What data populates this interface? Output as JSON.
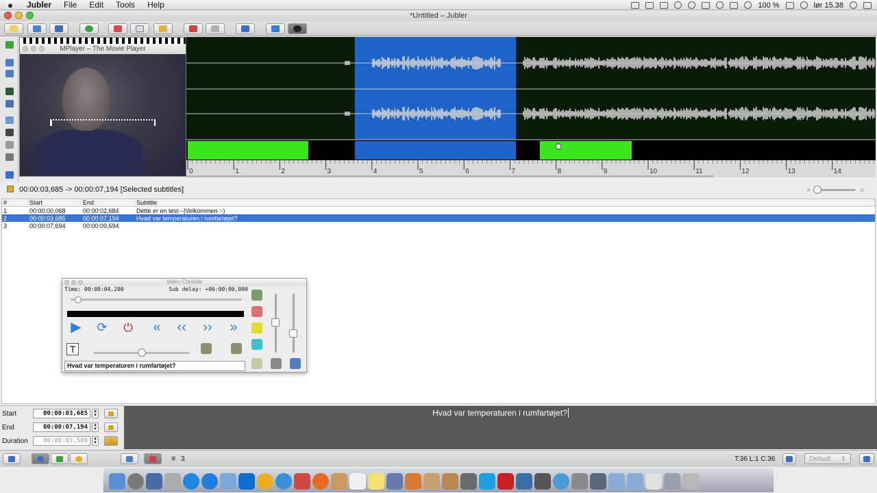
{
  "menubar": {
    "apple": "",
    "app_name": "Jubler",
    "items": [
      "File",
      "Edit",
      "Tools",
      "Help"
    ],
    "battery": "100 %",
    "clock": "lør 15.38"
  },
  "window": {
    "title": "*Untitled – Jubler"
  },
  "toolbar": {
    "icons": [
      "new-file-icon",
      "open-file-icon",
      "save-icon",
      "info-icon",
      "cut-icon",
      "copy-icon",
      "paste-icon",
      "undo-icon",
      "redo-icon",
      "sort-icon",
      "play-icon",
      "preview-eye-icon"
    ]
  },
  "mplayer": {
    "title": "MPlayer – The Movie Player"
  },
  "waveform": {
    "ruler_labels": [
      "0",
      "1",
      "2",
      "3",
      "4",
      "5",
      "6",
      "7",
      "8",
      "9",
      "10",
      "11",
      "12",
      "13",
      "14"
    ],
    "colors": {
      "selection": "#1e64c8",
      "subtitle_block": "#3ce61e",
      "background": "#0a1b0a",
      "wave": "#d2d2d2"
    }
  },
  "selection_info": "00:00:03,685 -> 00:00:07,194 [Selected subtitles]",
  "table": {
    "headers": [
      "#",
      "Start",
      "End",
      "Subtitle"
    ],
    "rows": [
      {
        "num": "1",
        "start": "00:00:00,068",
        "end": "00:00:02,684",
        "subtitle": "Dette er en test –|Velkommen :-)"
      },
      {
        "num": "2",
        "start": "00:00:03,685",
        "end": "00:00:07,194",
        "subtitle": "Hvad var temperaturen i rumfartøjet?"
      },
      {
        "num": "3",
        "start": "00:00:07,694",
        "end": "00:00:09,694",
        "subtitle": ""
      }
    ]
  },
  "video_console": {
    "title": "Video Console",
    "time": "Time: 00:00:04,200",
    "sub_delay": "Sub delay: +00:00:00,000",
    "subtitle_text": "Hvad var temperaturen i rumfartøjet?"
  },
  "edit": {
    "start_label": "Start",
    "start_value": "00:00:03,685",
    "end_label": "End",
    "end_value": "00:00:07,194",
    "duration_label": "Duration",
    "duration_value": "00:00:03,509",
    "subtitle_text": "Hvad var temperaturen i rumfartøjet?"
  },
  "statusbar": {
    "count": "3",
    "cursor_info": "T:36 L:1 C:36",
    "style_select": "Default"
  }
}
